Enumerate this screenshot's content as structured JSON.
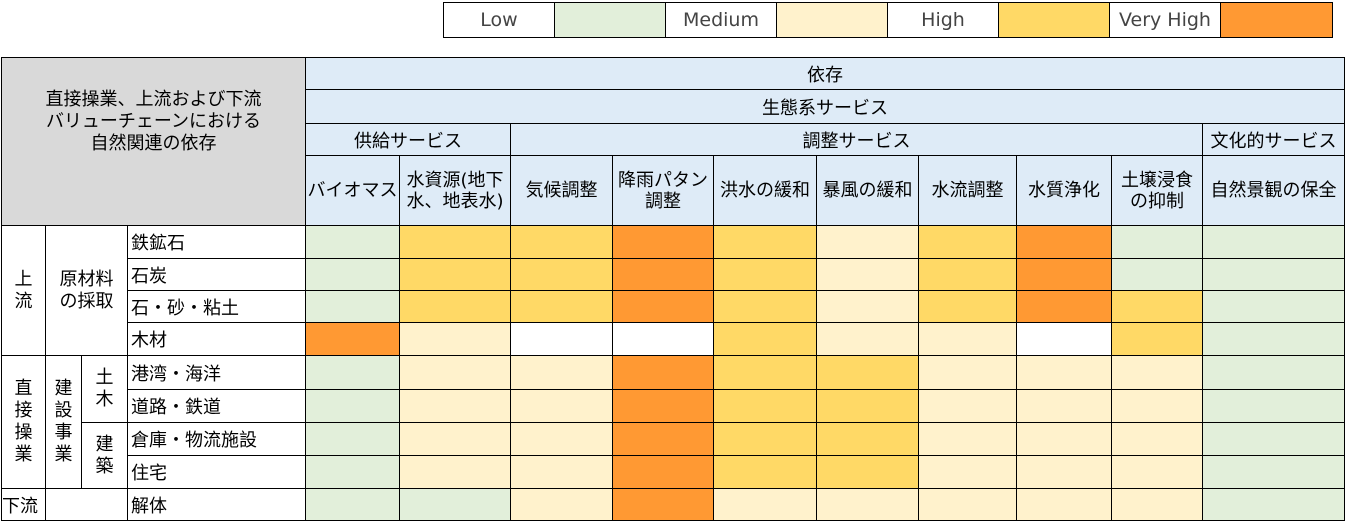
{
  "legend": [
    {
      "label": "Low",
      "color": "#e2efda"
    },
    {
      "label": "Medium",
      "color": "#fff2cc"
    },
    {
      "label": "High",
      "color": "#ffd966"
    },
    {
      "label": "Very High",
      "color": "#ff9933"
    }
  ],
  "header": {
    "corner": "直接操業、上流および下流\nバリューチェーンにおける\n自然関連の依存",
    "level1": "依存",
    "level2": "生態系サービス",
    "groups": {
      "provisioning": "供給サービス",
      "regulating": "調整サービス",
      "cultural": "文化的サービス"
    },
    "services": [
      "バイオマス",
      "水資源(地下\n水、地表水)",
      "気候調整",
      "降雨パタン\n調整",
      "洪水の緩和",
      "暴風の緩和",
      "水流調整",
      "水質浄化",
      "土壌浸食\nの抑制",
      "自然景観の保全"
    ]
  },
  "row_groups": {
    "upstream": "上\n流",
    "raw_materials": "原材料\nの採取",
    "direct_ops": "直\n接\n操\n業",
    "construction": "建\n設\n事\n業",
    "civil": "土\n木",
    "building": "建\n築",
    "downstream": "下流"
  },
  "chart_data": {
    "type": "heatmap",
    "title": "",
    "scale": [
      "Low",
      "Medium",
      "High",
      "Very High"
    ],
    "columns": [
      "バイオマス",
      "水資源(地下水、地表水)",
      "気候調整",
      "降雨パタン調整",
      "洪水の緩和",
      "暴風の緩和",
      "水流調整",
      "水質浄化",
      "土壌浸食の抑制",
      "自然景観の保全"
    ],
    "rows": [
      {
        "label": "鉄鉱石",
        "values": [
          "Low",
          "High",
          "High",
          "Very High",
          "High",
          "Medium",
          "High",
          "Very High",
          "Low",
          "Low"
        ]
      },
      {
        "label": "石炭",
        "values": [
          "Low",
          "High",
          "High",
          "Very High",
          "High",
          "Medium",
          "High",
          "Very High",
          "Low",
          "Low"
        ]
      },
      {
        "label": "石・砂・粘土",
        "values": [
          "Low",
          "High",
          "High",
          "Very High",
          "High",
          "Medium",
          "High",
          "Very High",
          "High",
          "Low"
        ]
      },
      {
        "label": "木材",
        "values": [
          "Very High",
          "Medium",
          "",
          "",
          "High",
          "Medium",
          "Medium",
          "",
          "High",
          "Low"
        ]
      },
      {
        "label": "港湾・海洋",
        "values": [
          "Low",
          "Medium",
          "Medium",
          "Very High",
          "High",
          "High",
          "Medium",
          "Medium",
          "Medium",
          "Low"
        ]
      },
      {
        "label": "道路・鉄道",
        "values": [
          "Low",
          "Medium",
          "Medium",
          "Very High",
          "High",
          "High",
          "Medium",
          "Medium",
          "Medium",
          "Low"
        ]
      },
      {
        "label": "倉庫・物流施設",
        "values": [
          "Low",
          "Medium",
          "Medium",
          "Very High",
          "High",
          "High",
          "Medium",
          "Medium",
          "Medium",
          "Low"
        ]
      },
      {
        "label": "住宅",
        "values": [
          "Low",
          "Medium",
          "Medium",
          "Very High",
          "High",
          "High",
          "Medium",
          "Medium",
          "Medium",
          "Low"
        ]
      },
      {
        "label": "解体",
        "values": [
          "Low",
          "Low",
          "Medium",
          "Very High",
          "Medium",
          "Medium",
          "Medium",
          "Medium",
          "Medium",
          "Low"
        ]
      }
    ]
  }
}
